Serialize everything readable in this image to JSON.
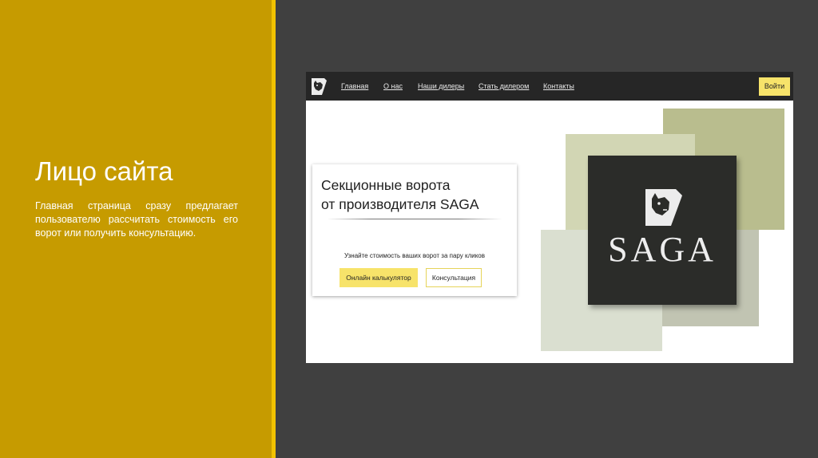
{
  "slide": {
    "title": "Лицо сайта",
    "text": "Главная страница сразу предлагает пользователю рассчитать стоимость его ворот или получить консультацию."
  },
  "site": {
    "nav": [
      "Главная",
      "О нас",
      "Наши дилеры",
      "Стать дилером",
      "Контакты"
    ],
    "login_label": "Войти",
    "logo_icon": "dog-head-logo-icon",
    "hero": {
      "title_line1": "Секционные ворота",
      "title_line2": "от производителя SAGA",
      "subtitle": "Узнайте стоимость ваших ворот за пару кликов",
      "calc_button": "Онлайн калькулятор",
      "consult_button": "Консультация"
    },
    "brand": "SAGA"
  },
  "colors": {
    "left_panel": "#c69b00",
    "accent_stripe": "#f2c200",
    "right_background": "#404040",
    "nav_background": "#262626",
    "button_yellow": "#f7e36a",
    "block_dark_olive": "#b9bd8e",
    "block_light_olive": "#d2d6b4",
    "block_grey_green": "#dadfd0",
    "logo_square": "#2b2c29"
  }
}
